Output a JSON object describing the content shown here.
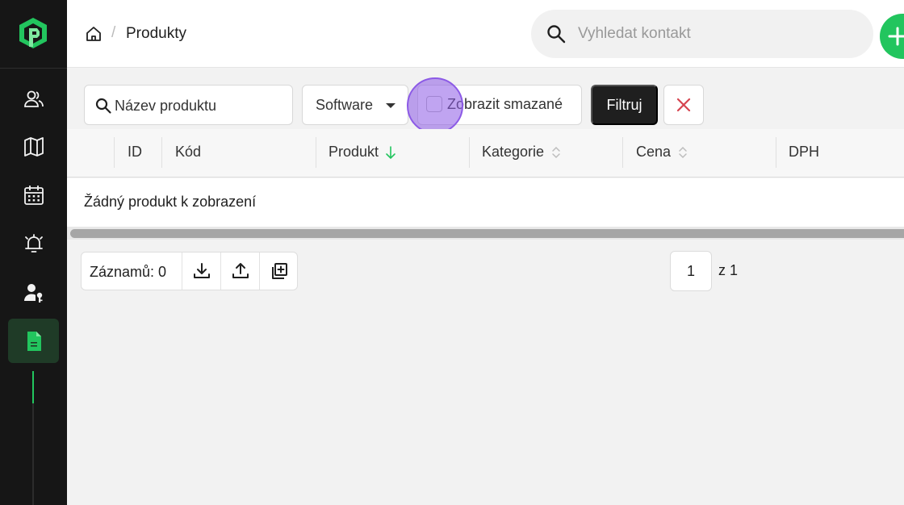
{
  "breadcrumb": {
    "current": "Produkty",
    "separator": "/"
  },
  "search": {
    "placeholder": "Vyhledat kontakt"
  },
  "sidebar": {
    "items": [
      {
        "name": "contacts",
        "icon": "users-icon"
      },
      {
        "name": "map",
        "icon": "map-icon"
      },
      {
        "name": "calendar",
        "icon": "calendar-icon"
      },
      {
        "name": "alarms",
        "icon": "alarm-icon"
      },
      {
        "name": "user-key",
        "icon": "user-key-icon"
      },
      {
        "name": "products",
        "icon": "document-icon",
        "active": true
      }
    ]
  },
  "filters": {
    "product_name_placeholder": "Název produktu",
    "category_selected": "Software",
    "show_deleted_label": "Zobrazit smazané",
    "show_deleted_checked": false,
    "filter_button": "Filtruj"
  },
  "table": {
    "columns": [
      {
        "label": "ID",
        "sort": "none"
      },
      {
        "label": "Kód",
        "sort": "none"
      },
      {
        "label": "Produkt",
        "sort": "desc"
      },
      {
        "label": "Kategorie",
        "sort": "sortable"
      },
      {
        "label": "Cena",
        "sort": "sortable"
      },
      {
        "label": "DPH",
        "sort": "none"
      }
    ],
    "empty_message": "Žádný produkt k zobrazení"
  },
  "footer": {
    "records_label": "Záznamů: 0",
    "page_value": "1",
    "page_total": "z 1"
  },
  "colors": {
    "accent": "#22c55e",
    "sidebar_bg": "#161616",
    "danger": "#d64550"
  }
}
